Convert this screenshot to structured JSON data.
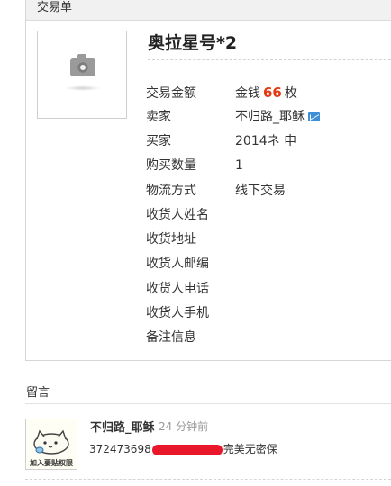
{
  "panel": {
    "header": "交易单"
  },
  "item": {
    "title": "奥拉星号*2"
  },
  "details": {
    "amount": {
      "label": "交易金额",
      "prefix": "金钱",
      "number": "66",
      "unit": "枚"
    },
    "seller": {
      "label": "卖家",
      "value": "不归路_耶稣"
    },
    "buyer": {
      "label": "买家",
      "value": "2014ネ 申"
    },
    "quantity": {
      "label": "购买数量",
      "value": "1"
    },
    "shipping": {
      "label": "物流方式",
      "value": "线下交易"
    },
    "recipient_name": {
      "label": "收货人姓名",
      "value": ""
    },
    "address": {
      "label": "收货地址",
      "value": ""
    },
    "postcode": {
      "label": "收货人邮编",
      "value": ""
    },
    "phone": {
      "label": "收货人电话",
      "value": ""
    },
    "mobile": {
      "label": "收货人手机",
      "value": ""
    },
    "notes": {
      "label": "备注信息",
      "value": ""
    }
  },
  "comments": {
    "label": "留言",
    "items": [
      {
        "author": "不归路_耶稣",
        "time": "24 分钟前",
        "text_before": "372473698",
        "text_after": "完美无密保",
        "avatar_caption": "加入要贴权限"
      }
    ]
  },
  "icons": {
    "image_placeholder": "camera-icon",
    "mail": "mail-icon"
  },
  "colors": {
    "amount": "#e23a14",
    "mail_icon": "#3d8fd8"
  }
}
